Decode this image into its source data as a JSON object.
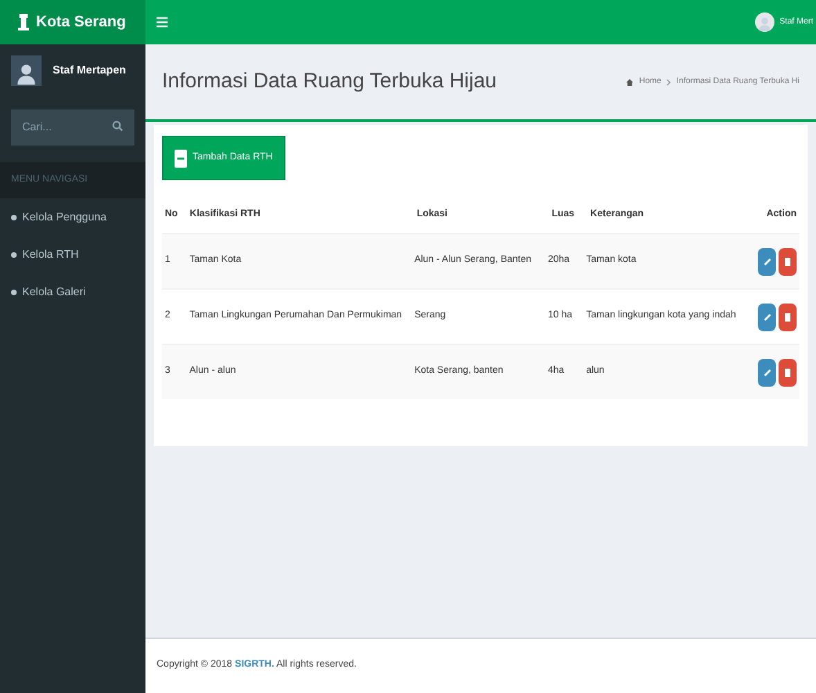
{
  "brand": "Kota Serang",
  "user": {
    "name": "Staf Mertapen",
    "top_name": "Staf Mert"
  },
  "search": {
    "placeholder": "Cari..."
  },
  "sidebar": {
    "header": "MENU NAVIGASI",
    "items": [
      {
        "label": "Kelola Pengguna"
      },
      {
        "label": "Kelola RTH"
      },
      {
        "label": "Kelola Galeri"
      }
    ]
  },
  "page_title": "Informasi Data Ruang Terbuka Hijau",
  "breadcrumb": [
    "Home",
    "Informasi Data Ruang Terbuka Hi"
  ],
  "add_button": "Tambah Data RTH",
  "table": {
    "columns": [
      "No",
      "Klasifikasi RTH",
      "Lokasi",
      "Luas",
      "Keterangan",
      "Action"
    ],
    "rows": [
      {
        "cells": [
          "1",
          "Taman Kota",
          "Alun - Alun Serang, Banten",
          "20ha",
          "Taman kota"
        ]
      },
      {
        "cells": [
          "2",
          "Taman Lingkungan Perumahan Dan Permukiman",
          "Serang",
          "10 ha",
          "Taman lingkungan kota yang indah"
        ]
      },
      {
        "cells": [
          "3",
          "Alun - alun",
          "Kota Serang, banten",
          "4ha",
          "alun"
        ]
      }
    ]
  },
  "footer": {
    "prefix": "Copyright © 2018",
    "link": "SIGRTH.",
    "suffix": "All rights reserved."
  }
}
